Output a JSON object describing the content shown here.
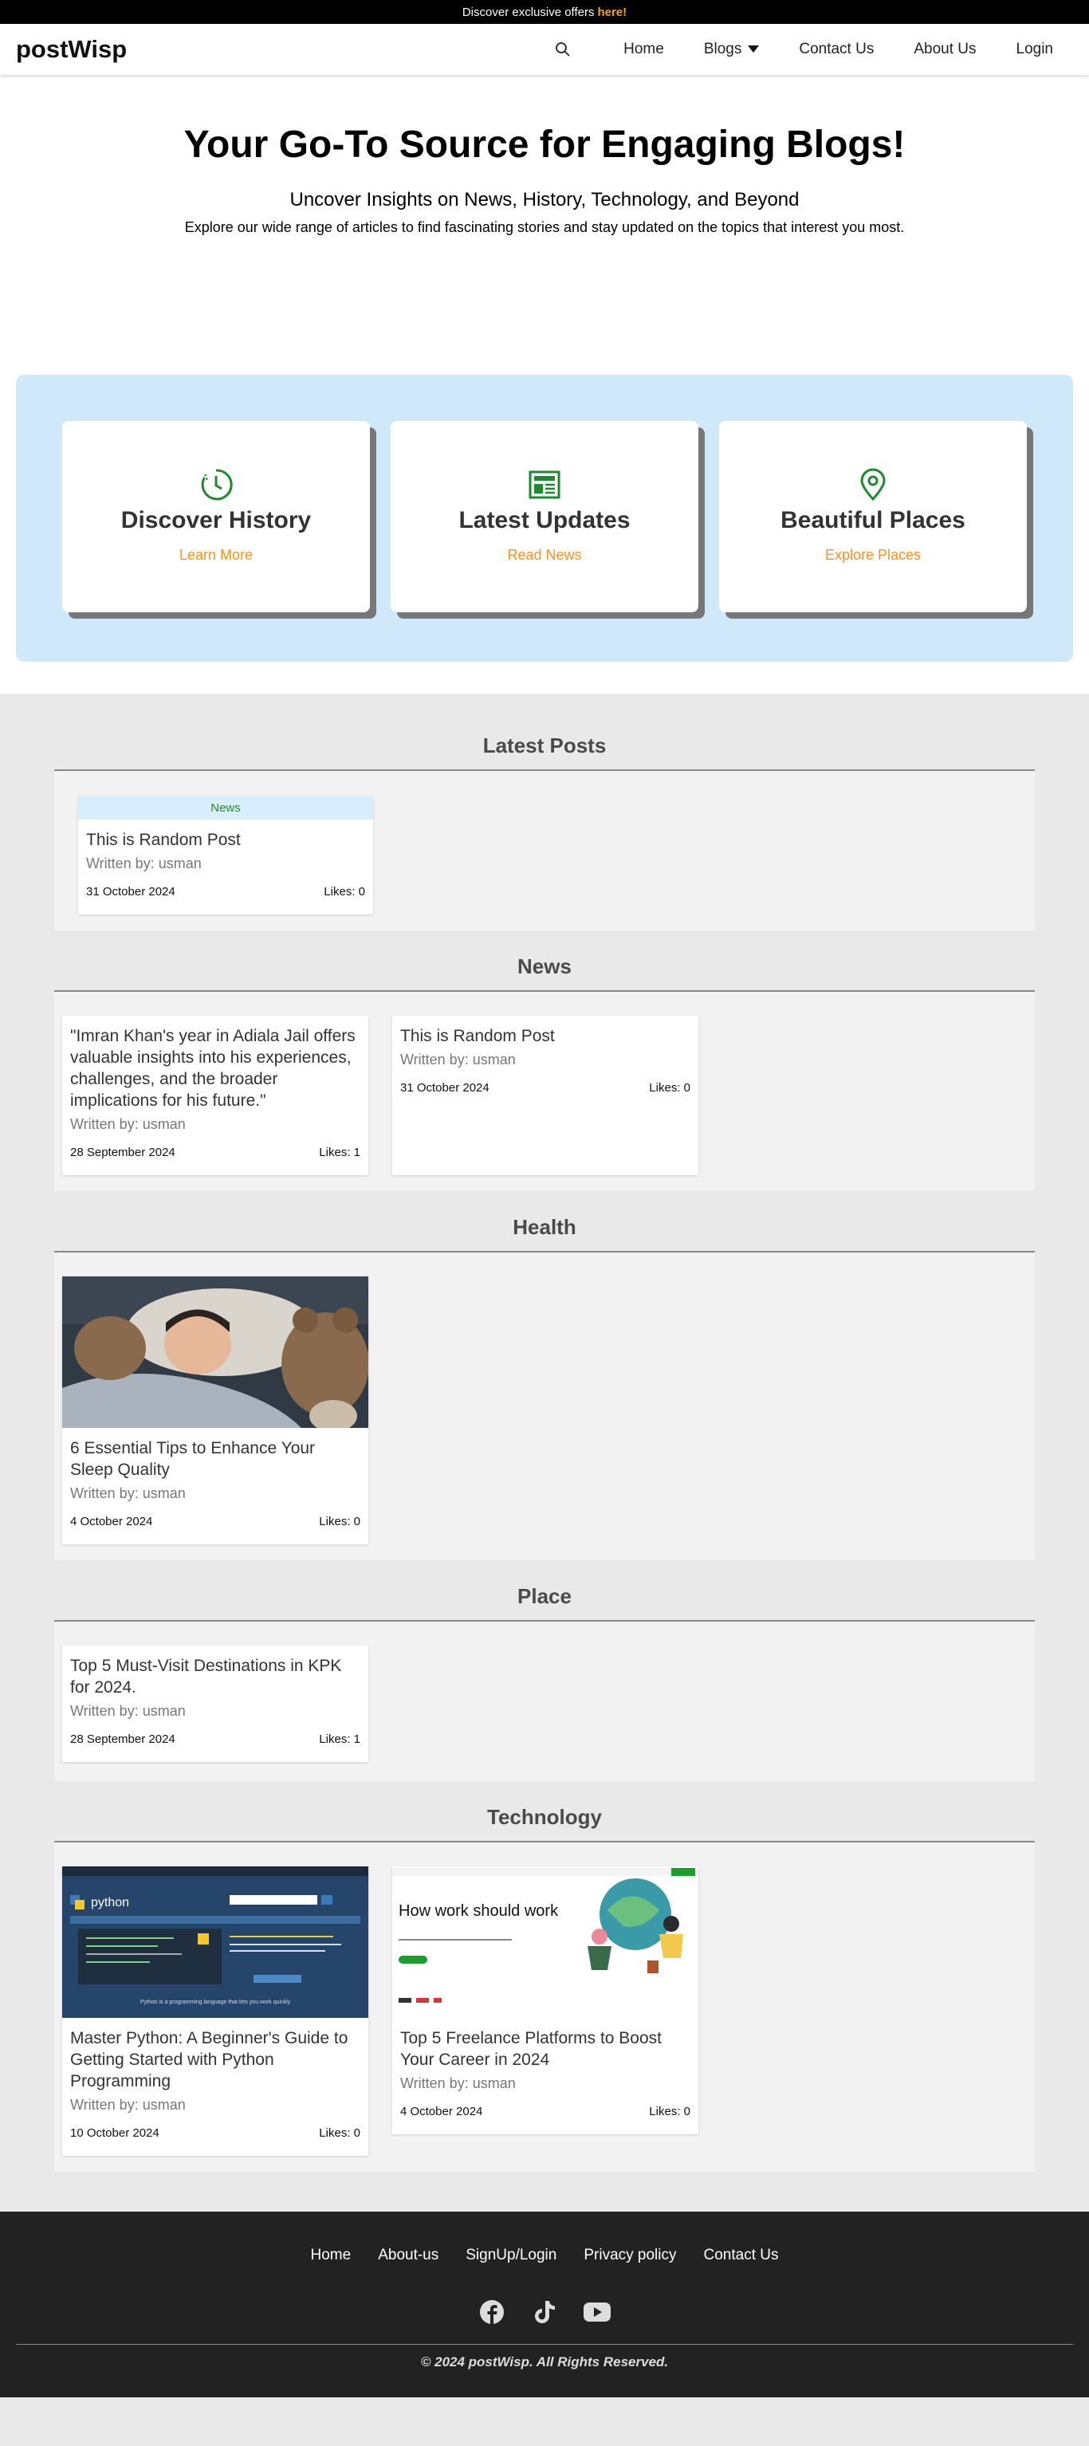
{
  "topbar": {
    "text": "Discover exclusive offers",
    "link": "here!"
  },
  "header": {
    "logo": "postWisp",
    "nav": {
      "home": "Home",
      "blogs": "Blogs",
      "contact": "Contact Us",
      "about": "About Us",
      "login": "Login"
    }
  },
  "hero": {
    "title": "Your Go-To Source for Engaging Blogs!",
    "subtitle": "Uncover Insights on News, History, Technology, and Beyond",
    "description": "Explore our wide range of articles to find fascinating stories and stay updated on the topics that interest you most."
  },
  "features": [
    {
      "icon": "history-clock-icon",
      "title": "Discover History",
      "link": "Learn More"
    },
    {
      "icon": "newspaper-icon",
      "title": "Latest Updates",
      "link": "Read News"
    },
    {
      "icon": "map-pin-icon",
      "title": "Beautiful Places",
      "link": "Explore Places"
    }
  ],
  "sections": {
    "latest": {
      "title": "Latest Posts",
      "posts": [
        {
          "tag": "News",
          "title": "This is Random Post",
          "author": "Written by: usman",
          "date": "31 October 2024",
          "likes": "Likes: 0"
        }
      ]
    },
    "news": {
      "title": "News",
      "posts": [
        {
          "title": "\"Imran Khan's year in Adiala Jail offers valuable insights into his experiences, challenges, and the broader implications for his future.\"",
          "author": "Written by: usman",
          "date": "28 September 2024",
          "likes": "Likes: 1"
        },
        {
          "title": "This is Random Post",
          "author": "Written by: usman",
          "date": "31 October 2024",
          "likes": "Likes: 0"
        }
      ]
    },
    "health": {
      "title": "Health",
      "posts": [
        {
          "title": "6 Essential Tips to Enhance Your Sleep Quality",
          "author": "Written by: usman",
          "date": "4 October 2024",
          "likes": "Likes: 0"
        }
      ]
    },
    "place": {
      "title": "Place",
      "posts": [
        {
          "title": "Top 5 Must-Visit Destinations in KPK for 2024.",
          "author": "Written by: usman",
          "date": "28 September 2024",
          "likes": "Likes: 1"
        }
      ]
    },
    "technology": {
      "title": "Technology",
      "posts": [
        {
          "title": "Master Python: A Beginner's Guide to Getting Started with Python Programming",
          "author": "Written by: usman",
          "date": "10 October 2024",
          "likes": "Likes: 0",
          "thumb_logo": "python",
          "thumb_tagline": "Python is a programming language that lets you work quickly"
        },
        {
          "title": "Top 5 Freelance Platforms to Boost Your Career in 2024",
          "author": "Written by: usman",
          "date": "4 October 2024",
          "likes": "Likes: 0",
          "thumb_heading": "How work should work"
        }
      ]
    }
  },
  "footer": {
    "links": {
      "home": "Home",
      "about": "About-us",
      "signup": "SignUp/Login",
      "privacy": "Privacy policy",
      "contact": "Contact Us"
    },
    "socials": [
      "facebook-icon",
      "tiktok-icon",
      "youtube-icon"
    ],
    "copyright": "© 2024 postWisp. All Rights Reserved."
  },
  "colors": {
    "accent": "#f7931e",
    "feature_bg": "#cfe9fb",
    "icon_green": "#1e8a2e",
    "footer_bg": "#222222"
  }
}
